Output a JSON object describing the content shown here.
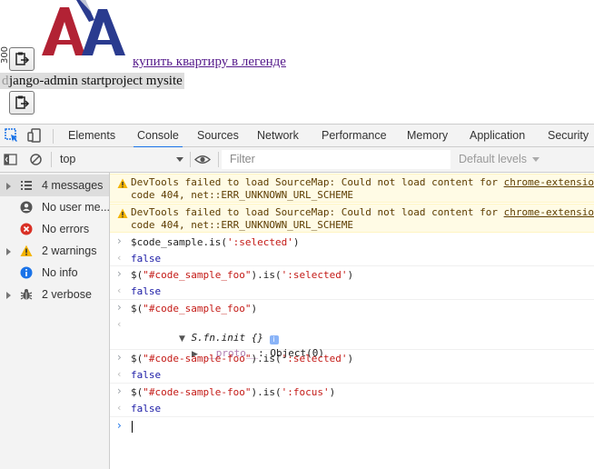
{
  "page": {
    "side_number": "300",
    "link_text": "купить квартиру в легенде",
    "code_line": "jango-admin startproject mysite",
    "code_line_first_char": "d"
  },
  "devtools": {
    "tabs": [
      "Elements",
      "Console",
      "Sources",
      "Network",
      "Performance",
      "Memory",
      "Application",
      "Security"
    ],
    "active_tab": "Console",
    "context": "top",
    "filter_placeholder": "Filter",
    "levels_label": "Default levels",
    "sidebar": [
      {
        "label": "4 messages",
        "icon": "list-icon",
        "expandable": true,
        "selected": true
      },
      {
        "label": "No user me...",
        "icon": "user-icon",
        "expandable": false,
        "selected": false
      },
      {
        "label": "No errors",
        "icon": "error-icon",
        "expandable": false,
        "selected": false
      },
      {
        "label": "2 warnings",
        "icon": "warning-icon",
        "expandable": true,
        "selected": false
      },
      {
        "label": "No info",
        "icon": "info-icon",
        "expandable": false,
        "selected": false
      },
      {
        "label": "2 verbose",
        "icon": "bug-icon",
        "expandable": true,
        "selected": false
      }
    ],
    "console": {
      "warnings": [
        {
          "line1_prefix": "DevTools failed to load SourceMap: Could not load content for ",
          "link": "chrome-extensio",
          "line2": "code 404, net::ERR_UNKNOWN_URL_SCHEME"
        },
        {
          "line1_prefix": "DevTools failed to load SourceMap: Could not load content for ",
          "link": "chrome-extensio",
          "line2": "code 404, net::ERR_UNKNOWN_URL_SCHEME"
        }
      ],
      "entries": [
        {
          "input_pre": "$code_sample.is(",
          "input_str": "':selected'",
          "input_post": ")",
          "output": "false"
        },
        {
          "input_pre": "$(",
          "input_str": "\"#code_sample_foo\"",
          "input_mid": ").is(",
          "input_str2": "':selected'",
          "input_post": ")",
          "output": "false"
        },
        {
          "input_pre": "$(",
          "input_str": "\"#code_sample_foo\"",
          "input_post": ")",
          "obj_label": "S.fn.init {}",
          "proto_key": "__proto__",
          "proto_val": ": Object(0)"
        },
        {
          "input_pre": "$(",
          "input_str": "\"#code-sample-foo\"",
          "input_mid": ").is(",
          "input_str2": "':selected'",
          "input_post": ")",
          "output": "false"
        },
        {
          "input_pre": "$(",
          "input_str": "\"#code-sample-foo\"",
          "input_mid": ").is(",
          "input_str2": "':focus'",
          "input_post": ")",
          "output": "false"
        }
      ]
    }
  },
  "colors": {
    "accent": "#1a73e8",
    "warning_bg": "#fffbe5",
    "string": "#c41a16",
    "keyword": "#1a1aa6"
  }
}
